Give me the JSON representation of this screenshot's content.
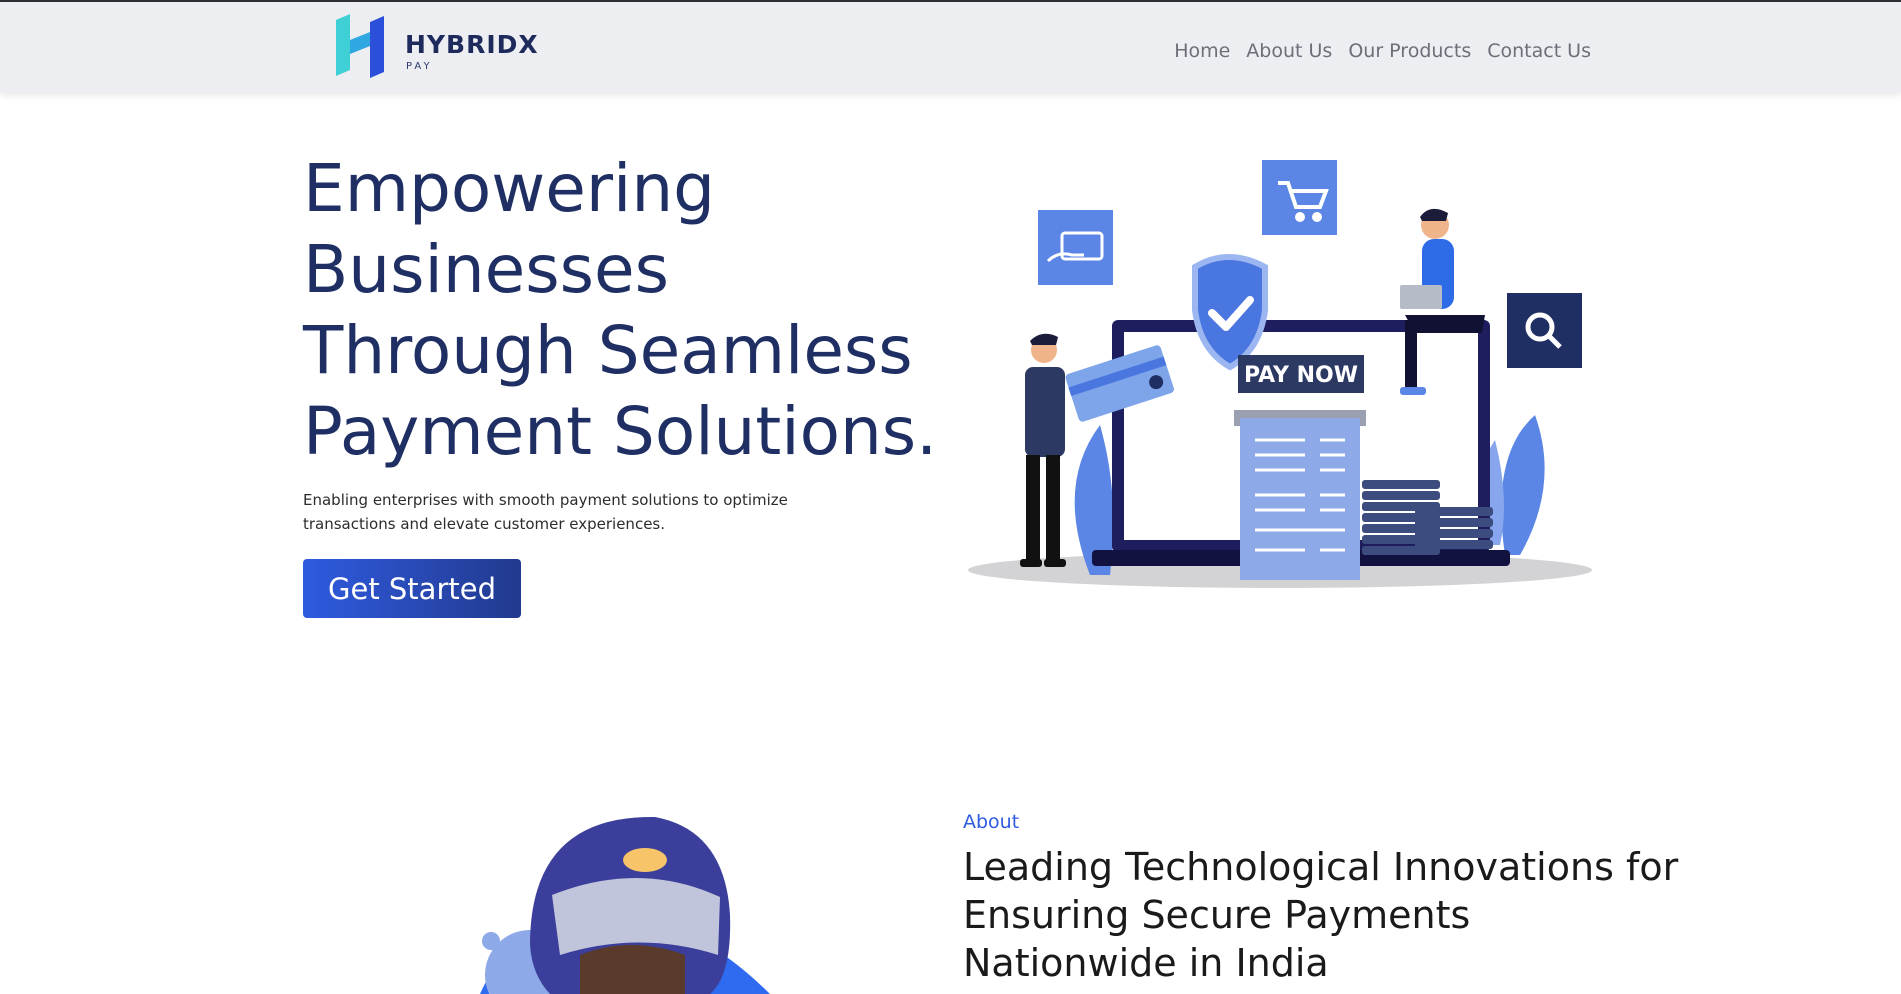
{
  "brand": {
    "name": "HYBRIDX",
    "tagline": "PAY"
  },
  "nav": {
    "items": [
      "Home",
      "About Us",
      "Our Products",
      "Contact Us"
    ]
  },
  "hero": {
    "title": "Empowering Businesses Through Seamless Payment Solutions.",
    "subtitle": "Enabling enterprises with smooth payment solutions to optimize transactions and elevate customer experiences.",
    "cta_label": "Get Started",
    "illustration": {
      "pay_now_label": "PAY NOW"
    }
  },
  "about": {
    "label": "About",
    "title": "Leading Technological Innovations for Ensuring Secure Payments Nationwide in India"
  },
  "colors": {
    "primary": "#2f5be0",
    "navy": "#1f2f64",
    "accent_light": "#5b86e5"
  }
}
